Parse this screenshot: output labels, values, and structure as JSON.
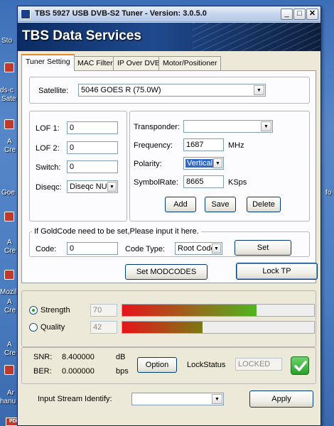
{
  "desktop": {
    "labels": [
      "Sto",
      "ds-c",
      "Sate",
      "A",
      "Cre",
      "Goe",
      "fo",
      "A",
      "Cre",
      "Mozill",
      "A",
      "Cre",
      "A",
      "Cre",
      "Ar",
      "hanu"
    ],
    "pdf_icon": "PDF"
  },
  "window": {
    "title": "TBS 5927 USB DVB-S2 Tuner - Version:  3.0.5.0",
    "controls": {
      "minimize": "_",
      "maximize": "□",
      "close": "✕"
    },
    "banner": "TBS Data Services"
  },
  "tabs": [
    {
      "label": "Tuner Setting",
      "active": true
    },
    {
      "label": "MAC Filter",
      "active": false
    },
    {
      "label": "IP Over DVB",
      "active": false
    },
    {
      "label": "Motor/Positioner",
      "active": false
    }
  ],
  "satellite": {
    "label": "Satellite:",
    "value": "5046  GOES R (75.0W)"
  },
  "lnb": {
    "lof1_label": "LOF 1:",
    "lof1_value": "0",
    "lof2_label": "LOF 2:",
    "lof2_value": "0",
    "switch_label": "Switch:",
    "switch_value": "0",
    "diseqc_label": "Diseqc:",
    "diseqc_value": "Diseqc NULL"
  },
  "transponder": {
    "transponder_label": "Transponder:",
    "transponder_value": "",
    "frequency_label": "Frequency:",
    "frequency_value": "1687",
    "frequency_unit": "MHz",
    "polarity_label": "Polarity:",
    "polarity_value": "Vertical",
    "symbolrate_label": "SymbolRate:",
    "symbolrate_value": "8665",
    "symbolrate_unit": "KSps",
    "add_label": "Add",
    "save_label": "Save",
    "delete_label": "Delete"
  },
  "goldcode": {
    "legend": "If GoldCode need to be set,Please input it here.",
    "code_label": "Code:",
    "code_value": "0",
    "code_type_label": "Code Type:",
    "code_type_value": "Root Code",
    "set_label": "Set"
  },
  "actions": {
    "set_modcodes_label": "Set MODCODES",
    "lock_tp_label": "Lock TP"
  },
  "signal": {
    "strength_label": "Strength",
    "strength_value": "70",
    "strength_percent": 70,
    "quality_label": "Quality",
    "quality_value": "42",
    "quality_percent": 42,
    "selected": "strength",
    "colors": {
      "start": "#e8131a",
      "strength_end": "#4fb51f",
      "quality_end": "#7a7a12"
    }
  },
  "status": {
    "snr_label": "SNR:",
    "snr_value": "8.400000",
    "snr_unit": "dB",
    "ber_label": "BER:",
    "ber_value": "0.000000",
    "ber_unit": "bps",
    "option_label": "Option",
    "lockstatus_label": "LockStatus",
    "lockstatus_value": "LOCKED",
    "lock_icon": "checkmark-icon"
  },
  "stream": {
    "label": "Input Stream Identify:",
    "value": "",
    "apply_label": "Apply"
  }
}
